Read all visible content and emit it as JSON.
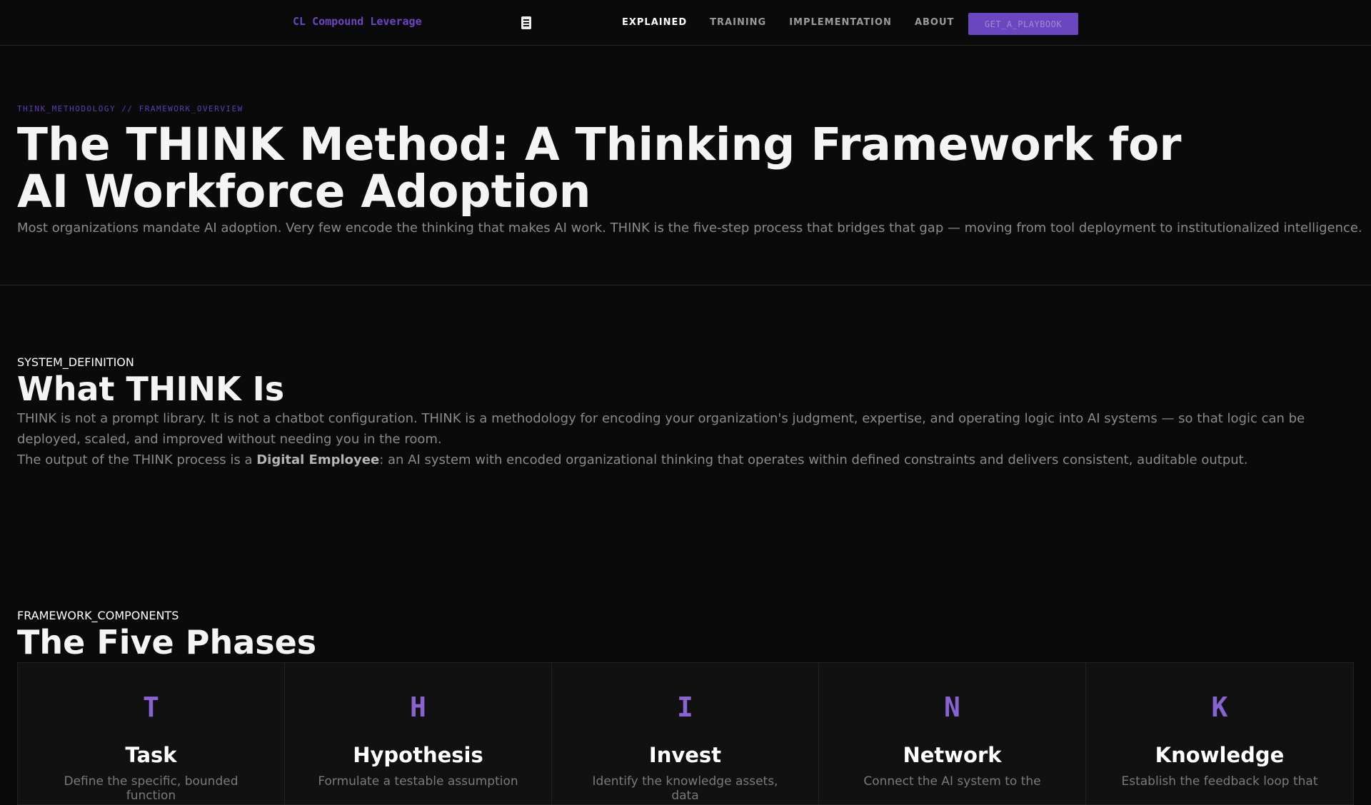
{
  "nav": {
    "logo": "CL Compound Leverage",
    "links": [
      "EXPLAINED",
      "TRAINING",
      "IMPLEMENTATION",
      "ABOUT"
    ],
    "cta": "GET_A_PLAYBOOK"
  },
  "hero": {
    "breadcrumb": "THINK_METHODOLOGY // FRAMEWORK_OVERVIEW",
    "title": "The THINK Method: A Thinking Framework for AI Workforce Adoption",
    "subtitle": "Most organizations mandate AI adoption. Very few encode the thinking that makes AI work. THINK is the five-step process that bridges that gap — moving from tool deployment to institutionalized intelligence."
  },
  "definition": {
    "label": "SYSTEM_DEFINITION",
    "heading": "What THINK Is",
    "p1": "THINK is not a prompt library. It is not a chatbot configuration. THINK is a methodology for encoding your organization's judgment, expertise, and operating logic into AI systems — so that logic can be deployed, scaled, and improved without needing you in the room.",
    "p2_pre": "The output of the THINK process is a ",
    "p2_bold": "Digital Employee",
    "p2_post": ": an AI system with encoded organizational thinking that operates within defined constraints and delivers consistent, auditable output."
  },
  "phases": {
    "label": "FRAMEWORK_COMPONENTS",
    "heading": "The Five Phases",
    "items": [
      {
        "letter": "T",
        "title": "Task",
        "desc": "Define the specific, bounded function"
      },
      {
        "letter": "H",
        "title": "Hypothesis",
        "desc": "Formulate a testable assumption"
      },
      {
        "letter": "I",
        "title": "Invest",
        "desc": "Identify the knowledge assets, data"
      },
      {
        "letter": "N",
        "title": "Network",
        "desc": "Connect the AI system to the"
      },
      {
        "letter": "K",
        "title": "Knowledge",
        "desc": "Establish the feedback loop that"
      }
    ]
  },
  "colors": {
    "accent": "#6b46c1",
    "letter": "#8a63d2",
    "bg": "#0a0a0a"
  }
}
